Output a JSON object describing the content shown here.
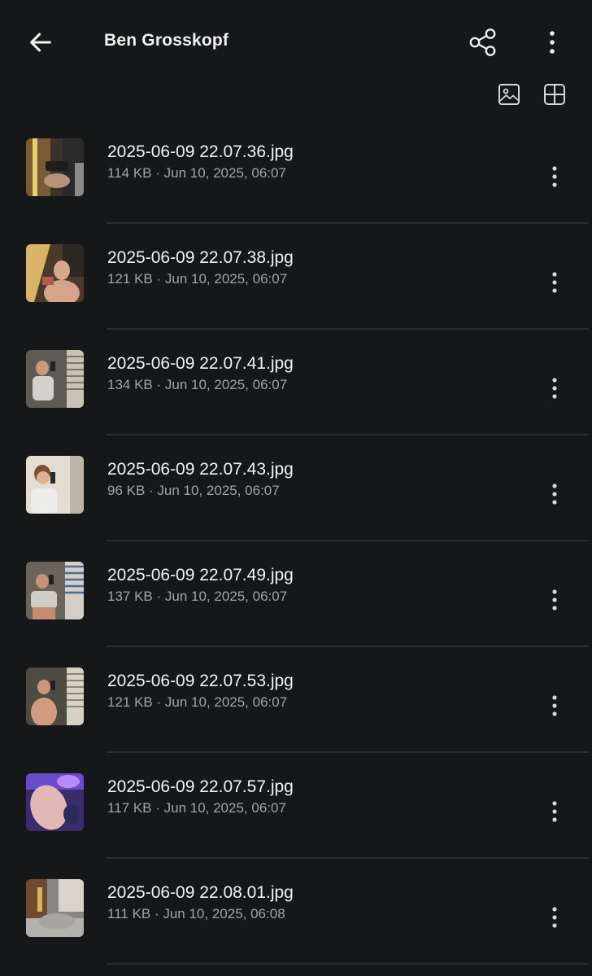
{
  "header": {
    "title": "Ben Grosskopf",
    "back_icon": "arrow-left-icon",
    "share_icon": "share-icon",
    "more_icon": "more-vertical-icon"
  },
  "view_toggles": {
    "image_view_icon": "image-icon",
    "grid_view_icon": "grid-icon"
  },
  "colors": {
    "background": "#161718",
    "text_primary": "#f2f2f2",
    "text_secondary": "#a3a3a3",
    "divider": "#2c2d2f"
  },
  "files": [
    {
      "name": "2025-06-09 22.07.36.jpg",
      "meta": "114 KB · Jun 10, 2025, 06:07"
    },
    {
      "name": "2025-06-09 22.07.38.jpg",
      "meta": "121 KB · Jun 10, 2025, 06:07"
    },
    {
      "name": "2025-06-09 22.07.41.jpg",
      "meta": "134 KB · Jun 10, 2025, 06:07"
    },
    {
      "name": "2025-06-09 22.07.43.jpg",
      "meta": "96 KB · Jun 10, 2025, 06:07"
    },
    {
      "name": "2025-06-09 22.07.49.jpg",
      "meta": "137 KB · Jun 10, 2025, 06:07"
    },
    {
      "name": "2025-06-09 22.07.53.jpg",
      "meta": "121 KB · Jun 10, 2025, 06:07"
    },
    {
      "name": "2025-06-09 22.07.57.jpg",
      "meta": "117 KB · Jun 10, 2025, 06:07"
    },
    {
      "name": "2025-06-09 22.08.01.jpg",
      "meta": "111 KB · Jun 10, 2025, 06:08"
    }
  ]
}
